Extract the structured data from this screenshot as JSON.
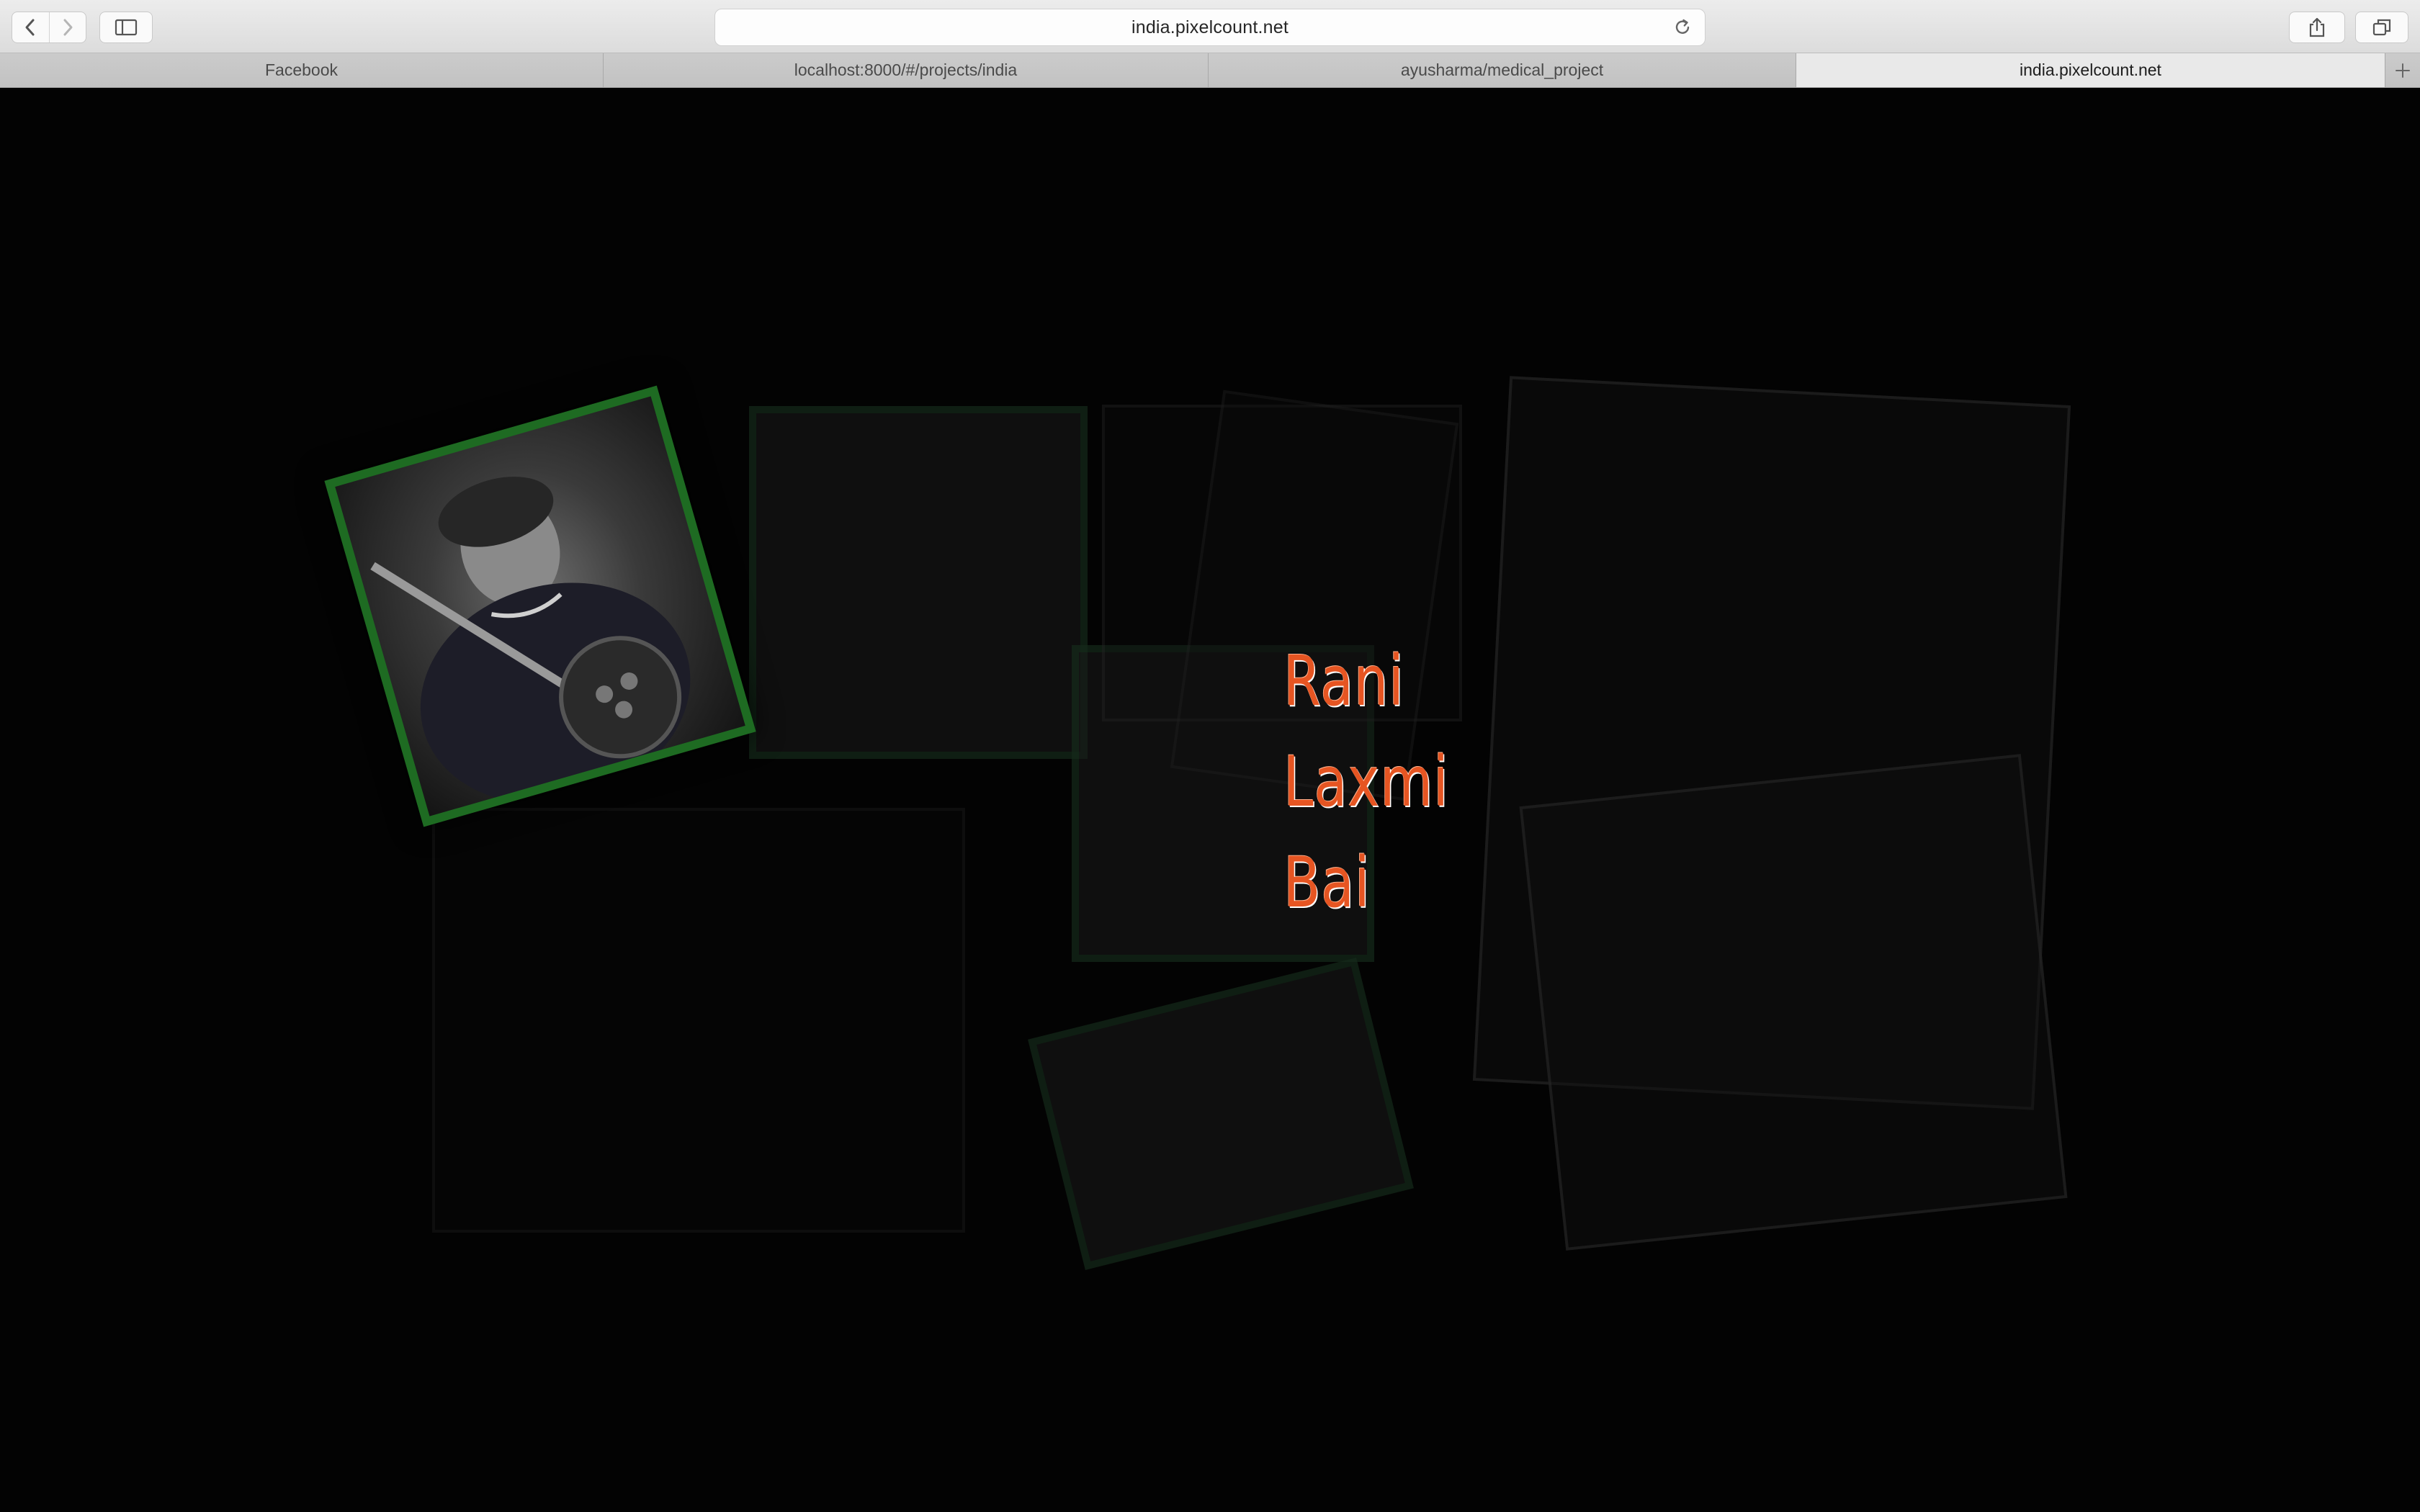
{
  "browser": {
    "url": "india.pixelcount.net",
    "tabs": [
      {
        "label": "Facebook",
        "active": false
      },
      {
        "label": "localhost:8000/#/projects/india",
        "active": false
      },
      {
        "label": "ayusharma/medical_project",
        "active": false
      },
      {
        "label": "india.pixelcount.net",
        "active": true
      }
    ],
    "icons": {
      "back": "chevron-left-icon",
      "forward": "chevron-right-icon",
      "sidebar": "sidebar-icon",
      "reload": "reload-icon",
      "share": "share-icon",
      "tabs_overview": "tabs-overview-icon",
      "new_tab": "plus-icon"
    }
  },
  "page": {
    "featured_name": {
      "line1": "Rani",
      "line2": "Laxmi",
      "line3": "Bai"
    },
    "colors": {
      "name": "#e65522",
      "frame_green": "#1e6b22",
      "background": "#030303"
    }
  }
}
